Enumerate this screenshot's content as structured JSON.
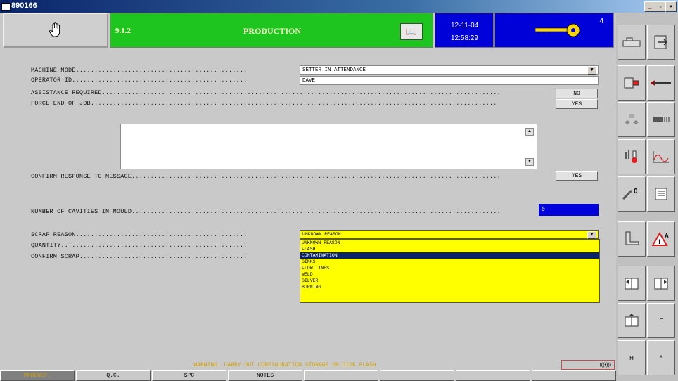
{
  "window": {
    "title": "890166"
  },
  "header": {
    "version": "9.1.2",
    "title": "PRODUCTION",
    "date": "12-11-04",
    "time": "12:58:29",
    "key_number": "4"
  },
  "form": {
    "machine_mode_label": "MACHINE MODE..............................................",
    "machine_mode_value": "SETTER IN ATTENDANCE",
    "operator_id_label": "OPERATOR ID...............................................",
    "operator_id_value": "DAVE",
    "assistance_label": "ASSISTANCE REQUIRED...........................................................................................................",
    "assistance_value": "NO",
    "force_end_label": "FORCE END OF JOB.............................................................................................................",
    "force_end_value": "YES",
    "confirm_response_label": "CONFIRM RESPONSE TO MESSAGE...................................................................................................",
    "confirm_response_value": "YES",
    "cavities_label": "NUMBER OF CAVITIES IN MOULD...................................................................................................",
    "cavities_value": "0",
    "scrap_reason_label": "SCRAP REASON..............................................",
    "scrap_reason_value": "UNKNOWN REASON",
    "quantity_label": "QUANTITY..................................................",
    "confirm_scrap_label": "CONFIRM SCRAP.............................................",
    "scrap_options": [
      "UNKNOWN REASON",
      "FLASH",
      "CONTAMINATION",
      "SINKS",
      "FLOW LINES",
      "WELD",
      "SILVER",
      "BURNING"
    ],
    "scrap_selected_index": 2
  },
  "warning": "WARNING: CARRY OUT CONFIGURATION STORAGE ON DISK FLASH",
  "alarm_text": "(((•)))",
  "tabs": [
    "PRODUCT.",
    "Q.C.",
    "SPC",
    "NOTES",
    "",
    "",
    "",
    ""
  ],
  "active_tab_index": 0,
  "sidebar_letters": {
    "f": "F",
    "h": "H",
    "star": "*"
  },
  "colors": {
    "header_green": "#1ec51e",
    "header_blue": "#0000d8",
    "warning": "#d2a000",
    "dropdown_yellow": "#ffff00"
  }
}
